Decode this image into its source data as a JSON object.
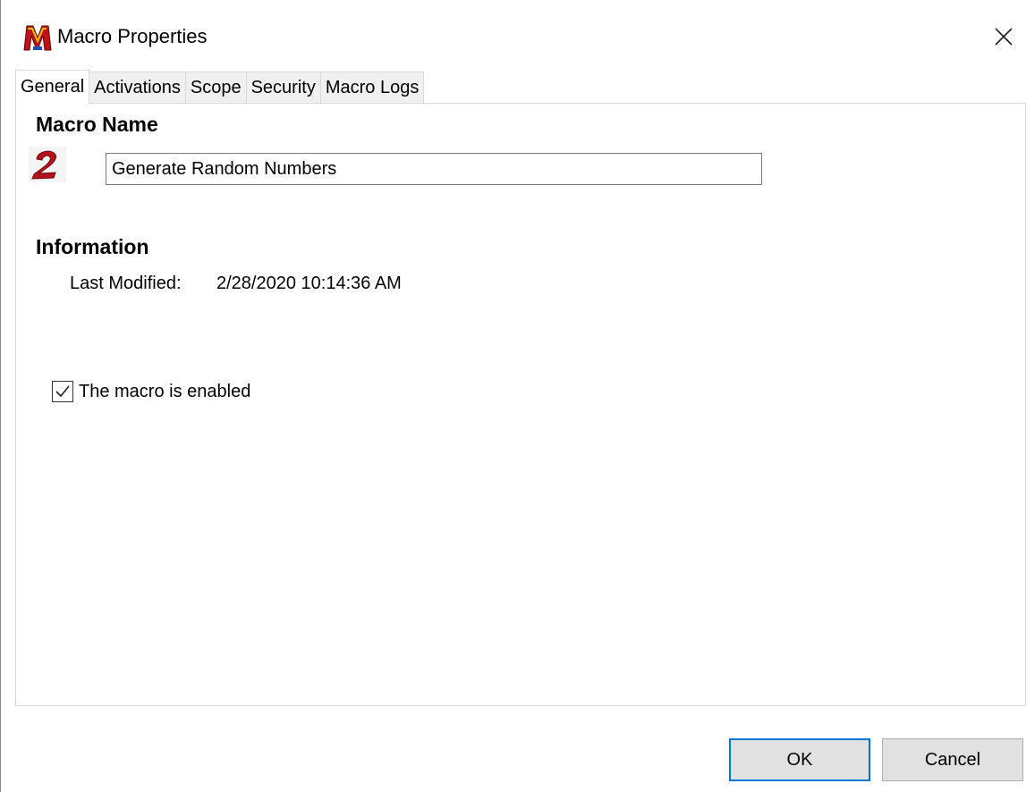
{
  "window": {
    "title": "Macro Properties",
    "app_icon": "keyboard-maestro-m-icon",
    "close_icon": "close-icon"
  },
  "tabs": [
    {
      "label": "General",
      "active": true
    },
    {
      "label": "Activations",
      "active": false
    },
    {
      "label": "Scope",
      "active": false
    },
    {
      "label": "Security",
      "active": false
    },
    {
      "label": "Macro Logs",
      "active": false
    }
  ],
  "general": {
    "macro_name_heading": "Macro Name",
    "macro_icon": "red-2-macro-icon",
    "macro_name_value": "Generate Random Numbers",
    "information_heading": "Information",
    "last_modified_label": "Last Modified:",
    "last_modified_value": "2/28/2020 10:14:36 AM",
    "enabled_label": "The macro is enabled",
    "enabled_checked": true
  },
  "buttons": {
    "ok_label": "OK",
    "cancel_label": "Cancel"
  },
  "colors": {
    "accent": "#0078d7",
    "macro_icon_red": "#b5121b"
  }
}
